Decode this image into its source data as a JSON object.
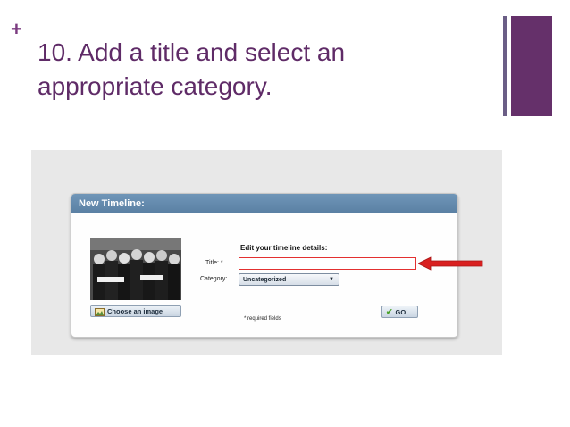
{
  "slide": {
    "bullet": "+",
    "title": "10. Add a title and select an appropriate category."
  },
  "dialog": {
    "header": "New Timeline:",
    "details_heading": "Edit your timeline details:",
    "title_label": "Title: *",
    "title_value": "",
    "category_label": "Category:",
    "category_value": "Uncategorized",
    "choose_image_label": "Choose an image",
    "go_label": "GO!",
    "required_note": "* required fields"
  },
  "colors": {
    "slide_title": "#5f2b67",
    "deco_block": "#65306a",
    "header_blue": "#6388ad",
    "highlight_red": "#e33030",
    "arrow_red": "#d92020"
  },
  "icons": [
    "plus-icon",
    "image-icon",
    "dropdown-arrow-icon",
    "checkmark-icon",
    "red-arrow-icon"
  ]
}
